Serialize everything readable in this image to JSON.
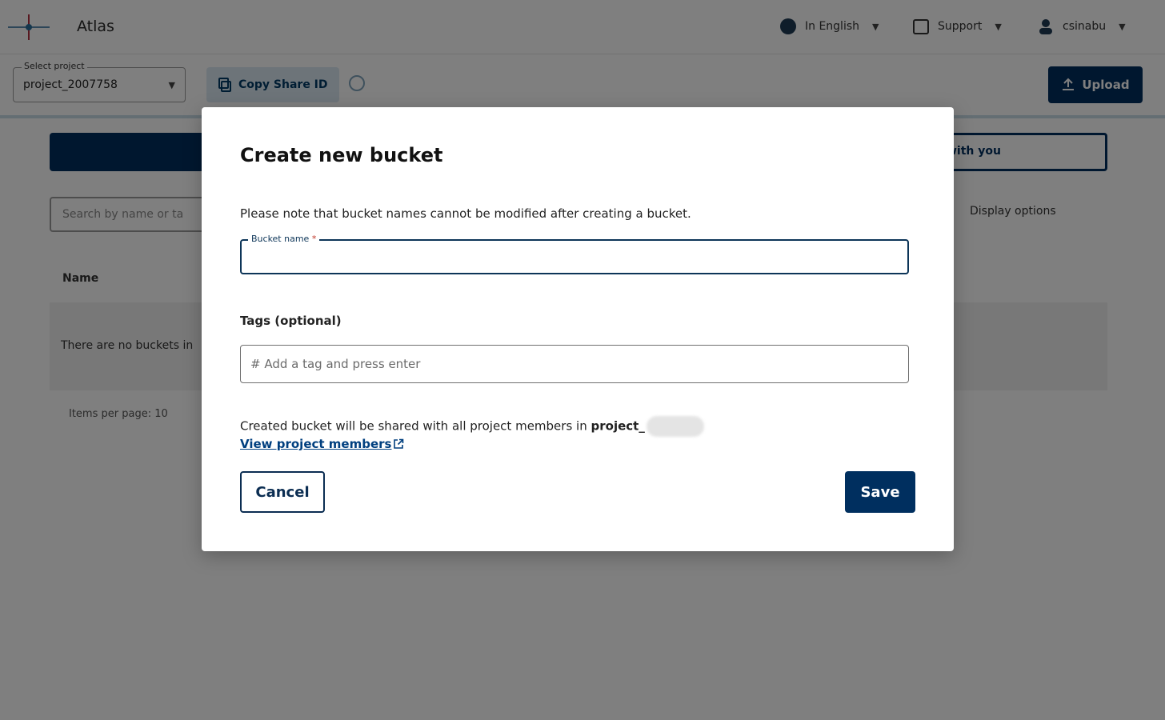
{
  "background": {
    "app_name": "Atlas",
    "language": "In English",
    "support": "Support",
    "user": "csinabu",
    "project_select_label": "Select project",
    "project_select_value": "project_2007758",
    "copy_share_id": "Copy Share ID",
    "upload": "Upload",
    "shared_tab": "with you",
    "search_placeholder": "Search by name or ta",
    "display_options": "Display options",
    "column_name": "Name",
    "empty_message": "There are no buckets in",
    "items_per_page": "Items per page: 10"
  },
  "modal": {
    "title": "Create new bucket",
    "note": "Please note that bucket names cannot be modified after creating a bucket.",
    "bucket_name_label": "Bucket name",
    "required_mark": "*",
    "bucket_name_value": "",
    "tags_label": "Tags (optional)",
    "tags_placeholder": "# Add a tag and press enter",
    "share_text": "Created bucket will be shared with all project members in",
    "project_name": "project_",
    "members_link": "View project members",
    "cancel_label": "Cancel",
    "save_label": "Save"
  }
}
